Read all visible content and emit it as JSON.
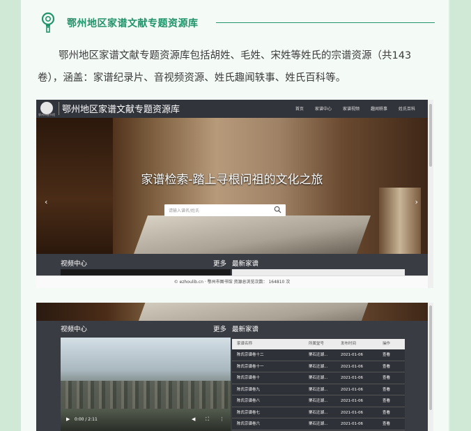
{
  "section": {
    "title": "鄂州地区家谱文献专题资源库",
    "paragraph": "鄂州地区家谱文献专题资源库包括胡姓、毛姓、宋姓等姓氏的宗谱资源（共143卷），涵盖：家谱纪录片、音视频资源、姓氏趣闻轶事、姓氏百科等。",
    "accent_color": "#22936b",
    "icon": "lightbulb-icon"
  },
  "site": {
    "title": "鄂州地区家谱文献专题资源库",
    "logo_sub": "鄂州市图书馆",
    "nav": [
      "首页",
      "家谱中心",
      "家谱视频",
      "趣闻轶事",
      "姓氏百科"
    ],
    "hero_title": "家谱检索-踏上寻根问祖的文化之旅",
    "search_placeholder": "请输入谱名/姓氏",
    "video_center": "视频中心",
    "more": "更多",
    "newest": "最新家谱",
    "footer": "© ezhoulib.cn · 鄂州市图书馆 资源总浏览次数：  164810 次"
  },
  "player": {
    "time": "0:00 / 2:11"
  },
  "table": {
    "headers": [
      "家谱名称",
      "所属堂号",
      "发布时间",
      "操作"
    ],
    "rows": [
      [
        "陈氏宗谱卷十二",
        "栗石迁湖...",
        "2021-01-06",
        "查看"
      ],
      [
        "陈氏宗谱卷十一",
        "栗石迁湖...",
        "2021-01-06",
        "查看"
      ],
      [
        "陈氏宗谱卷十",
        "栗石迁湖...",
        "2021-01-06",
        "查看"
      ],
      [
        "陈氏宗谱卷九",
        "栗石迁湖...",
        "2021-01-06",
        "查看"
      ],
      [
        "陈氏宗谱卷八",
        "栗石迁湖...",
        "2021-01-06",
        "查看"
      ],
      [
        "陈氏宗谱卷七",
        "栗石迁湖...",
        "2021-01-06",
        "查看"
      ],
      [
        "陈氏宗谱卷六",
        "栗石迁湖...",
        "2021-01-06",
        "查看"
      ]
    ]
  }
}
